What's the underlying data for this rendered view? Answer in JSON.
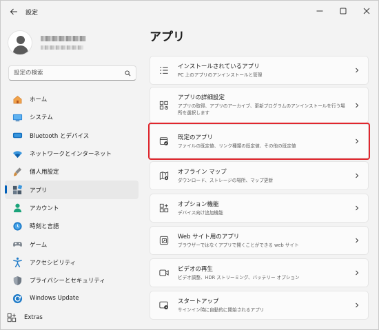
{
  "window": {
    "title": "設定"
  },
  "search": {
    "placeholder": "設定の検索"
  },
  "sidebar": {
    "items": [
      {
        "label": "ホーム",
        "icon": "home-icon"
      },
      {
        "label": "システム",
        "icon": "system-icon"
      },
      {
        "label": "Bluetooth とデバイス",
        "icon": "bluetooth-icon"
      },
      {
        "label": "ネットワークとインターネット",
        "icon": "network-icon"
      },
      {
        "label": "個人用設定",
        "icon": "personalization-icon"
      },
      {
        "label": "アプリ",
        "icon": "apps-icon",
        "active": true
      },
      {
        "label": "アカウント",
        "icon": "account-icon"
      },
      {
        "label": "時刻と言語",
        "icon": "time-language-icon"
      },
      {
        "label": "ゲーム",
        "icon": "gaming-icon"
      },
      {
        "label": "アクセシビリティ",
        "icon": "accessibility-icon"
      },
      {
        "label": "プライバシーとセキュリティ",
        "icon": "privacy-icon"
      },
      {
        "label": "Windows Update",
        "icon": "windows-update-icon"
      }
    ],
    "extras_label": "Extras"
  },
  "main": {
    "title": "アプリ",
    "cards": [
      {
        "title": "インストールされているアプリ",
        "subtitle": "PC 上のアプリのアンインストールと管理",
        "icon": "installed-apps-icon"
      },
      {
        "title": "アプリの詳細設定",
        "subtitle": "アプリの取得、アプリのアーカイブ、更新プログラムのアンインストールを行う場所を選択します",
        "icon": "advanced-app-settings-icon"
      },
      {
        "title": "既定のアプリ",
        "subtitle": "ファイルの既定値、リンク種類の既定値、その他の既定値",
        "icon": "default-apps-icon",
        "highlighted": true
      },
      {
        "title": "オフライン マップ",
        "subtitle": "ダウンロード、ストレージの場所、マップ更新",
        "icon": "offline-maps-icon"
      },
      {
        "title": "オプション機能",
        "subtitle": "デバイス向け追加機能",
        "icon": "optional-features-icon"
      },
      {
        "title": "Web サイト用のアプリ",
        "subtitle": "ブラウザーではなくアプリで開くことができる web サイト",
        "icon": "apps-for-websites-icon"
      },
      {
        "title": "ビデオの再生",
        "subtitle": "ビデオ調整、HDR ストリーミング、バッテリー オプション",
        "icon": "video-playback-icon"
      },
      {
        "title": "スタートアップ",
        "subtitle": "サインイン時に自動的に開始されるアプリ",
        "icon": "startup-icon"
      }
    ]
  }
}
